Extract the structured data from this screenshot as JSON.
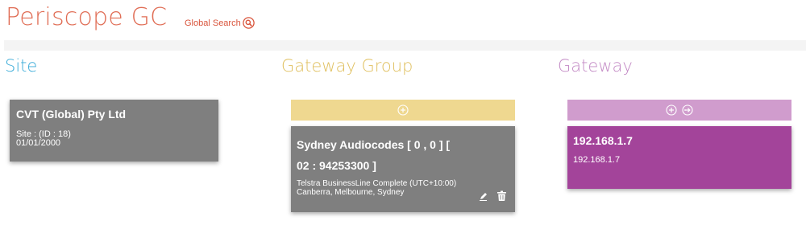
{
  "header": {
    "app_title": "Periscope GC",
    "global_search_label": "Global Search"
  },
  "columns": {
    "site": "Site",
    "gateway_group": "Gateway Group",
    "gateway": "Gateway"
  },
  "site_card": {
    "name": "CVT (Global) Pty Ltd",
    "id_line": "Site : (ID : 18)",
    "date": "01/01/2000"
  },
  "group_card": {
    "name_line1": "Sydney Audiocodes [ 0 , 0 ] [",
    "name_line2": "02 : 94253300 ]",
    "detail": "Telstra BusinessLine Complete (UTC+10:00) Canberra, Melbourne, Sydney"
  },
  "gateway_card": {
    "name": "192.168.1.7",
    "ip": "192.168.1.7"
  },
  "icons": {
    "search": "magnifier-circle-icon",
    "add": "plus-circle-icon",
    "link": "arrow-circle-icon",
    "edit": "pencil-icon",
    "delete": "trash-icon"
  },
  "colors": {
    "title": "#e06d55",
    "site": "#3aabd8",
    "gateway_group": "#e0c060",
    "gateway": "#c38ac5",
    "card_gray": "#7f7f7f",
    "gateway_card": "#a3449a"
  }
}
